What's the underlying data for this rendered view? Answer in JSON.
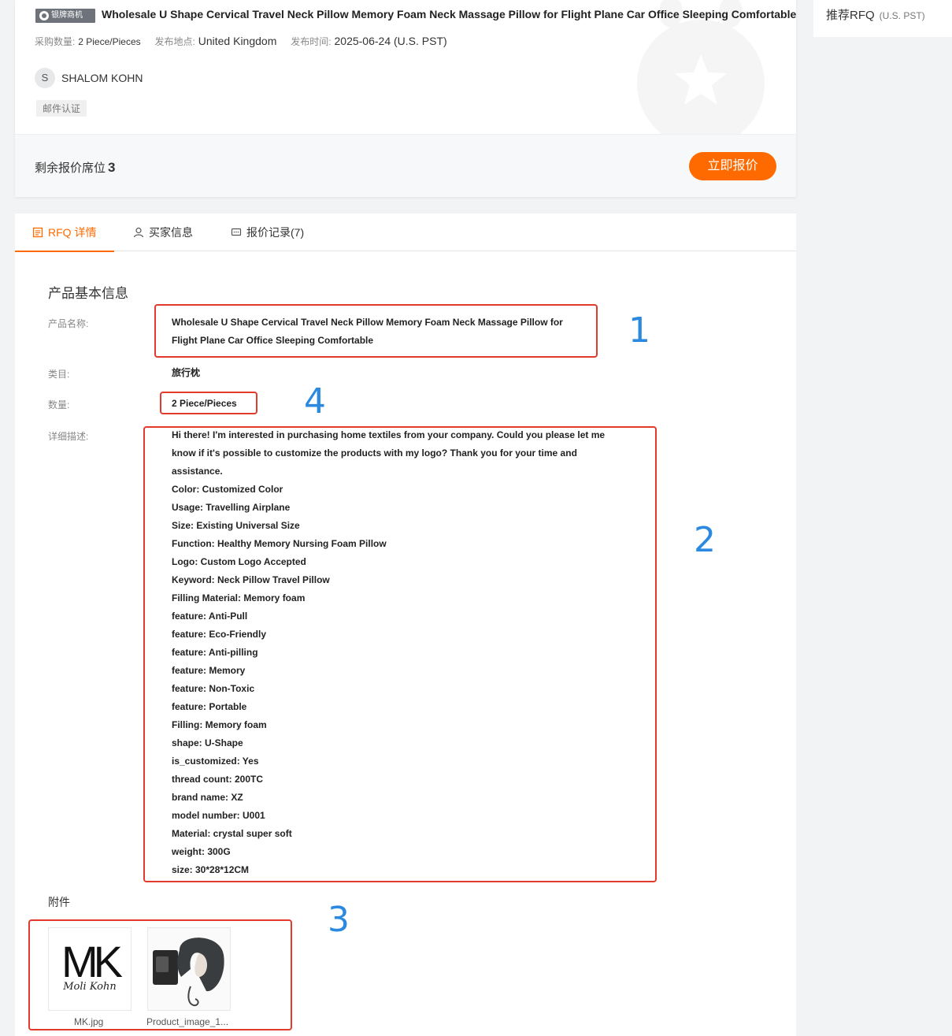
{
  "rfq": {
    "badge": "银牌商机",
    "title": "Wholesale U Shape Cervical Travel Neck Pillow Memory Foam Neck Massage Pillow for Flight Plane Car Office Sleeping Comfortable",
    "qty_label": "采购数量:",
    "qty_value": "2 Piece/Pieces",
    "location_label": "发布地点:",
    "location_value": "United Kingdom",
    "time_label": "发布时间:",
    "time_value": "2025-06-24 (U.S. PST)",
    "buyer_initial": "S",
    "buyer_name": "SHALOM KOHN",
    "verify_tag": "邮件认证",
    "remaining_label": "剩余报价席位",
    "remaining_count": "3",
    "quote_button": "立即报价"
  },
  "sidebar": {
    "title": "推荐RFQ",
    "timezone": "(U.S. PST)"
  },
  "tabs": [
    {
      "label": "RFQ 详情",
      "icon": "document-icon"
    },
    {
      "label": "买家信息",
      "icon": "user-icon"
    },
    {
      "label": "报价记录(7)",
      "icon": "chat-icon"
    }
  ],
  "detail": {
    "section_title": "产品基本信息",
    "name_label": "产品名称:",
    "name_value": "Wholesale U Shape Cervical Travel Neck Pillow Memory Foam Neck Massage Pillow for Flight Plane Car Office Sleeping Comfortable",
    "category_label": "类目:",
    "category_value": "旅行枕",
    "quantity_label": "数量:",
    "quantity_value": "2 Piece/Pieces",
    "desc_label": "详细描述:",
    "desc_intro": "Hi there! I'm interested in purchasing home textiles from your company. Could you please let me know if it's possible to customize the products with my logo? Thank you for your time and assistance.",
    "desc_lines": [
      "Color: Customized Color",
      "Usage: Travelling Airplane",
      "Size: Existing Universal Size",
      "Function: Healthy Memory Nursing Foam Pillow",
      "Logo: Custom Logo Accepted",
      "Keyword: Neck Pillow Travel Pillow",
      "Filling Material: Memory foam",
      "feature: Anti-Pull",
      "feature: Eco-Friendly",
      "feature: Anti-pilling",
      "feature: Memory",
      "feature: Non-Toxic",
      "feature: Portable",
      "Filling: Memory foam",
      "shape: U-Shape",
      "is_customized: Yes",
      "thread count: 200TC",
      "brand name: XZ",
      "model number: U001",
      "Material: crystal super soft",
      "weight: 300G",
      "size: 30*28*12CM"
    ],
    "attach_title": "附件",
    "attachments": [
      {
        "name": "MK.jpg",
        "logo_big": "MK",
        "logo_script": "Moli Kohn"
      },
      {
        "name": "Product_image_1..."
      }
    ]
  },
  "annotations": [
    "1",
    "2",
    "3",
    "4"
  ],
  "colors": {
    "accent": "#ff6a00",
    "annotation_box": "#e23b2e",
    "annotation_number": "#2b8ae0"
  }
}
